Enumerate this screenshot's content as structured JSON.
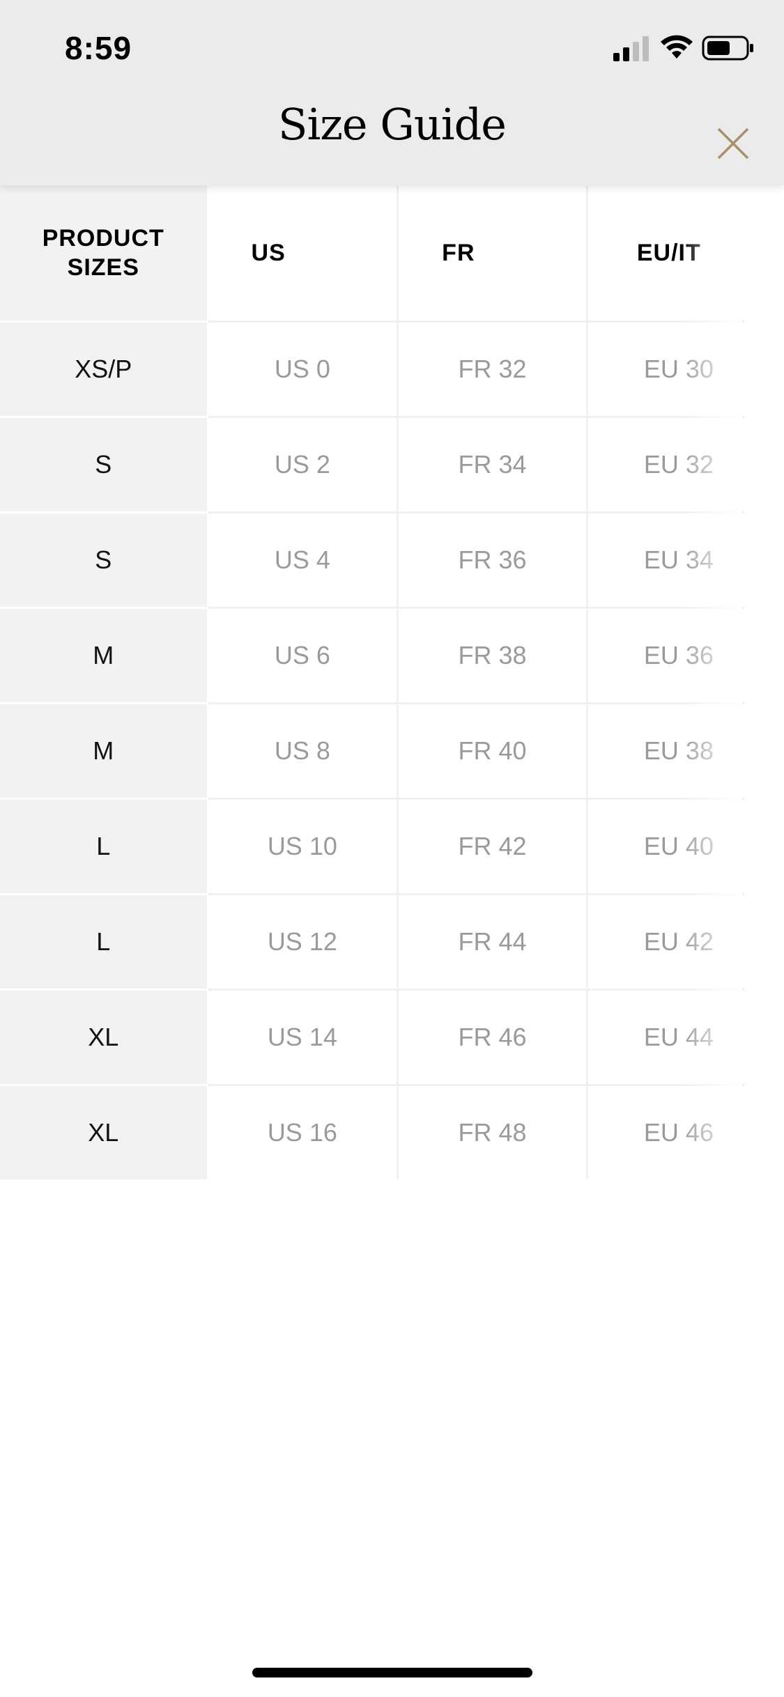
{
  "status_bar": {
    "time": "8:59"
  },
  "header": {
    "title": "Size Guide",
    "close_icon": "close-icon",
    "accent_color": "#a8916a"
  },
  "table": {
    "headers": {
      "product": "PRODUCT SIZES",
      "us": "US",
      "fr": "FR",
      "eu": "EU/IT"
    },
    "rows": [
      {
        "product": "XS/P",
        "us": "US 0",
        "fr": "FR 32",
        "eu": "EU 30"
      },
      {
        "product": "S",
        "us": "US 2",
        "fr": "FR 34",
        "eu": "EU 32"
      },
      {
        "product": "S",
        "us": "US 4",
        "fr": "FR 36",
        "eu": "EU 34"
      },
      {
        "product": "M",
        "us": "US 6",
        "fr": "FR 38",
        "eu": "EU 36"
      },
      {
        "product": "M",
        "us": "US 8",
        "fr": "FR 40",
        "eu": "EU 38"
      },
      {
        "product": "L",
        "us": "US 10",
        "fr": "FR 42",
        "eu": "EU 40"
      },
      {
        "product": "L",
        "us": "US 12",
        "fr": "FR 44",
        "eu": "EU 42"
      },
      {
        "product": "XL",
        "us": "US 14",
        "fr": "FR 46",
        "eu": "EU 44"
      },
      {
        "product": "XL",
        "us": "US 16",
        "fr": "FR 48",
        "eu": "EU 46"
      }
    ]
  }
}
